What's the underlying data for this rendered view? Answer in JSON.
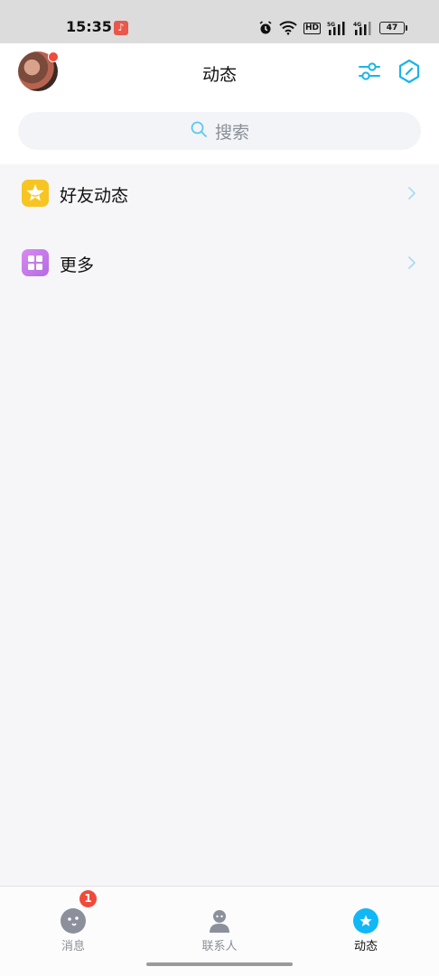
{
  "status_bar": {
    "time": "15:35",
    "network_badge": "HD",
    "signal1_label": "5G",
    "signal2_label": "4G",
    "battery": "47"
  },
  "header": {
    "title": "动态",
    "search_placeholder": "搜索"
  },
  "list": {
    "items": [
      {
        "label": "好友动态",
        "icon": "star-icon",
        "color": "#f7c522"
      },
      {
        "label": "更多",
        "icon": "grid-icon",
        "color": "#c77de8"
      }
    ]
  },
  "bottom_nav": {
    "tabs": [
      {
        "label": "消息",
        "icon": "message-icon",
        "badge": "1"
      },
      {
        "label": "联系人",
        "icon": "contacts-icon"
      },
      {
        "label": "动态",
        "icon": "feed-star-icon",
        "active": true
      }
    ]
  },
  "colors": {
    "accent": "#12b7f5",
    "badge": "#f04a3a",
    "background": "#f6f6f9"
  }
}
